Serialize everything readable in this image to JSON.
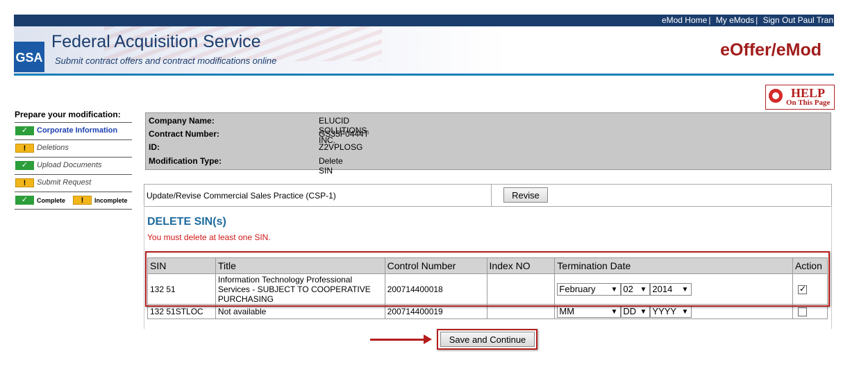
{
  "header": {
    "links": [
      "eMod Home",
      "My eMods",
      "Sign Out Paul Tran"
    ],
    "logo_text": "GSA",
    "title": "Federal Acquisition Service",
    "subtitle": "Submit contract offers and contract modifications online",
    "app_name": "eOffer/eMod",
    "help_line1": "HELP",
    "help_line2": "On This Page"
  },
  "sidebar": {
    "heading": "Prepare your modification:",
    "steps": [
      {
        "label": "Corporate Information",
        "status": "complete"
      },
      {
        "label": "Deletions",
        "status": "incomplete"
      },
      {
        "label": "Upload Documents",
        "status": "complete"
      },
      {
        "label": "Submit Request",
        "status": "incomplete"
      }
    ],
    "legend_complete": "Complete",
    "legend_incomplete": "Incomplete",
    "check_glyph": "✓",
    "warn_glyph": "!"
  },
  "info": {
    "rows": [
      {
        "key": "Company Name:",
        "value": "ELUCID SOLUTIONS, INC."
      },
      {
        "key": "Contract Number:",
        "value": "GS35F0444T"
      },
      {
        "key": "ID:",
        "value": "Z2VPLOSG"
      },
      {
        "key": "Modification Type:",
        "value": "Delete SIN"
      }
    ]
  },
  "csp": {
    "text": "Update/Revise Commercial Sales Practice (CSP-1)",
    "button": "Revise"
  },
  "delete_section": {
    "title": "DELETE SIN(s)",
    "note": "You must delete at least one SIN.",
    "columns": [
      "SIN",
      "Title",
      "Control Number",
      "Index NO",
      "Termination Date",
      "Action"
    ],
    "rows": [
      {
        "sin": "132 51",
        "title": "Information Technology Professional Services - SUBJECT TO COOPERATIVE PURCHASING",
        "control": "200714400018",
        "index": "",
        "month": "February",
        "day": "02",
        "year": "2014",
        "checked": true
      },
      {
        "sin": "132 51STLOC",
        "title": "Not available",
        "control": "200714400019",
        "index": "",
        "month": "MM",
        "day": "DD",
        "year": "YYYY",
        "checked": false
      }
    ]
  },
  "actions": {
    "save": "Save and Continue"
  },
  "colors": {
    "navy": "#1b3d6d",
    "accent_red": "#a11c1c",
    "highlight_red": "#b51d1d",
    "complete_green": "#2c9e3a",
    "incomplete_yellow": "#f2b61b",
    "section_blue": "#1d6a9e"
  }
}
